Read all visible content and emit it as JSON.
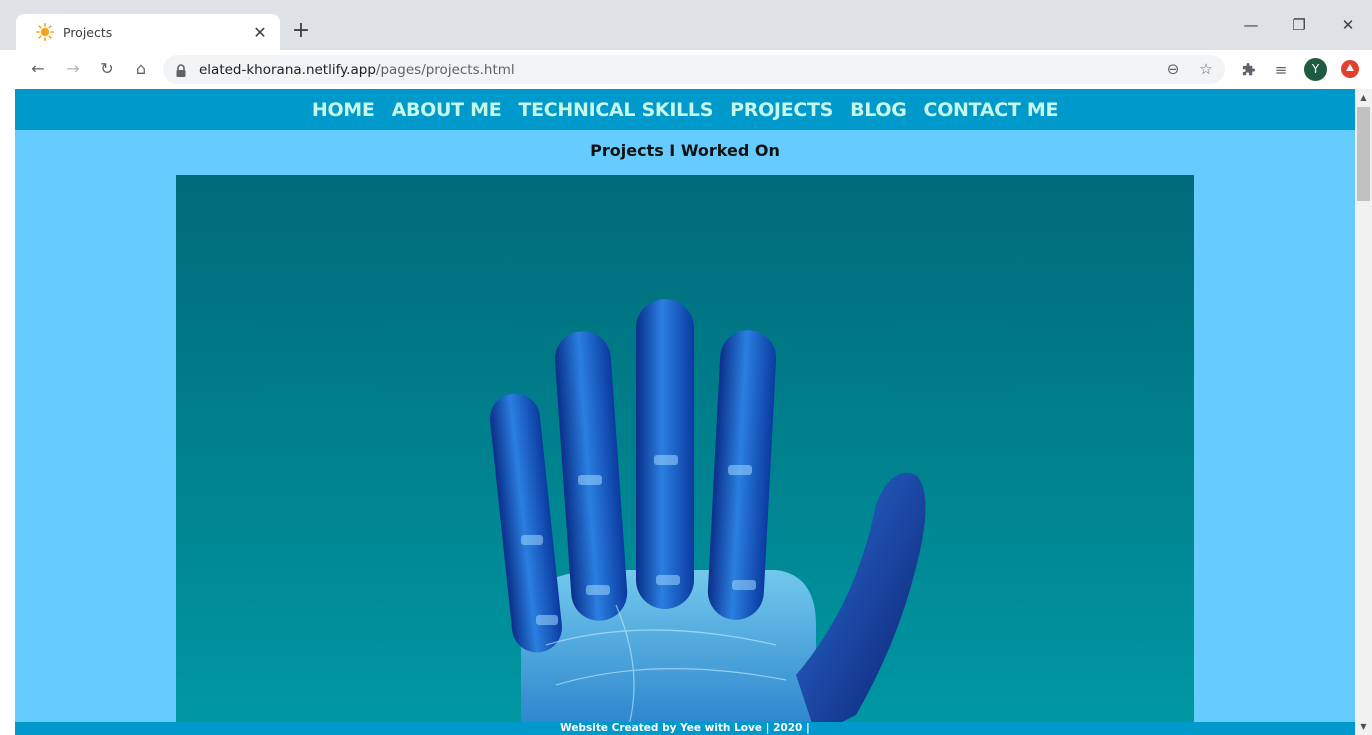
{
  "browser": {
    "tab_title": "Projects",
    "tab_close": "✕",
    "new_tab": "+",
    "url_host": "elated-khorana.netlify.app",
    "url_path": "/pages/projects.html",
    "profile_initial": "Y",
    "icons": {
      "back": "←",
      "forward": "→",
      "reload": "↻",
      "home": "⌂",
      "zoom": "⊖",
      "bookmark": "☆",
      "extensions": "puzzle-icon",
      "media": "≡",
      "minimize": "—",
      "restore": "❐",
      "close": "✕"
    }
  },
  "page": {
    "nav": [
      {
        "label": "HOME"
      },
      {
        "label": "ABOUT ME"
      },
      {
        "label": "TECHNICAL SKILLS"
      },
      {
        "label": "PROJECTS"
      },
      {
        "label": "BLOG"
      },
      {
        "label": "CONTACT ME"
      }
    ],
    "heading": "Projects I Worked On",
    "footer": "Website Created by Yee with Love | 2020 |",
    "colors": {
      "navbar_bg": "#0099cc",
      "page_bg": "#66ccff",
      "nav_text": "#c6f7ea"
    }
  },
  "scrollbar": {
    "up": "▲",
    "down": "▼"
  }
}
